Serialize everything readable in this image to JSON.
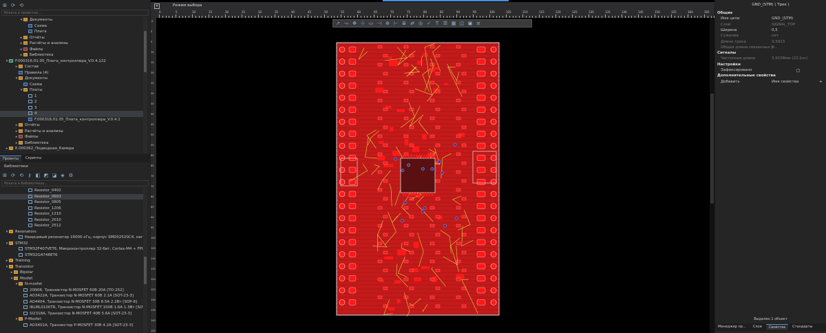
{
  "projects_panel": {
    "search_placeholder": "Искать в проектах...",
    "tree": [
      {
        "label": "Документы",
        "indent": 4,
        "icon": "folder",
        "arrow": "▾"
      },
      {
        "label": "Схема",
        "indent": 5,
        "icon": "doc",
        "arrow": ""
      },
      {
        "label": "Плата",
        "indent": 5,
        "icon": "doc",
        "arrow": ""
      },
      {
        "label": "Отчёты",
        "indent": 4,
        "icon": "folder",
        "arrow": "▸"
      },
      {
        "label": "Расчёты и анализы",
        "indent": 4,
        "icon": "folder",
        "arrow": "▸"
      },
      {
        "label": "Файлы",
        "indent": 4,
        "icon": "red",
        "arrow": "▸"
      },
      {
        "label": "Библиотека",
        "indent": 4,
        "icon": "folder",
        "arrow": "▸"
      },
      {
        "label": "F.000316.01.05_Плата_контроллера_V.0.4.122",
        "indent": 1,
        "icon": "cube",
        "arrow": "▾"
      },
      {
        "label": "Состав",
        "indent": 3,
        "icon": "folder",
        "arrow": "▸"
      },
      {
        "label": "Правила (4)",
        "indent": 3,
        "icon": "doc",
        "arrow": ""
      },
      {
        "label": "Документы",
        "indent": 3,
        "icon": "folder",
        "arrow": "▾"
      },
      {
        "label": "Схема",
        "indent": 4,
        "icon": "doc",
        "arrow": ""
      },
      {
        "label": "Платы",
        "indent": 4,
        "icon": "folder",
        "arrow": "▾"
      },
      {
        "label": "1",
        "indent": 5,
        "icon": "box",
        "arrow": ""
      },
      {
        "label": "2",
        "indent": 5,
        "icon": "box",
        "arrow": ""
      },
      {
        "label": "3",
        "indent": 5,
        "icon": "box",
        "arrow": ""
      },
      {
        "label": "4",
        "indent": 5,
        "icon": "box",
        "arrow": "",
        "sel": true
      },
      {
        "label": "F.000316.01.05_Плата_контроллера_V.0.4.1",
        "indent": 5,
        "icon": "doc",
        "arrow": ""
      },
      {
        "label": "Отчёты",
        "indent": 3,
        "icon": "folder",
        "arrow": "▸"
      },
      {
        "label": "Расчёты и анализы",
        "indent": 3,
        "icon": "folder",
        "arrow": "▸"
      },
      {
        "label": "Файлы",
        "indent": 3,
        "icon": "red",
        "arrow": "▸"
      },
      {
        "label": "Библиотека",
        "indent": 3,
        "icon": "folder",
        "arrow": "▸"
      },
      {
        "label": "E.000362_Подводная_Камера",
        "indent": 1,
        "icon": "folder",
        "arrow": "▸"
      }
    ],
    "tabs": [
      "Проекты",
      "Скрипты"
    ]
  },
  "libraries_panel": {
    "title": "Библиотеки",
    "search_placeholder": "Искать в библиотеках...",
    "tree": [
      {
        "label": "Resistor_0402",
        "indent": 5,
        "icon": "box",
        "arrow": ""
      },
      {
        "label": "Resistor_0603",
        "indent": 5,
        "icon": "box",
        "arrow": "",
        "sel": true
      },
      {
        "label": "Resistor_0805",
        "indent": 5,
        "icon": "box",
        "arrow": ""
      },
      {
        "label": "Resistor_1206",
        "indent": 5,
        "icon": "box",
        "arrow": ""
      },
      {
        "label": "Resistor_1210",
        "indent": 5,
        "icon": "box",
        "arrow": ""
      },
      {
        "label": "Resistor_2010",
        "indent": 5,
        "icon": "box",
        "arrow": ""
      },
      {
        "label": "Resistor_2512",
        "indent": 5,
        "icon": "box",
        "arrow": ""
      },
      {
        "label": "Resonators",
        "indent": 1,
        "icon": "folder",
        "arrow": "▾"
      },
      {
        "label": "Кварцевый резонатор 16000 кГц, корпус SMD02520C4, нагрузоч...",
        "indent": 3,
        "icon": "box",
        "arrow": ""
      },
      {
        "label": "STM32",
        "indent": 1,
        "icon": "folder",
        "arrow": "▾"
      },
      {
        "label": "STM32F407VET6, Микроконтроллер 32-бит, Cortex-M4 + FPU, 168...",
        "indent": 3,
        "icon": "box",
        "arrow": ""
      },
      {
        "label": "STM32G474RET6",
        "indent": 3,
        "icon": "box",
        "arrow": ""
      },
      {
        "label": "Training",
        "indent": 1,
        "icon": "folder",
        "arrow": "▸"
      },
      {
        "label": "Transistor",
        "indent": 1,
        "icon": "folder",
        "arrow": "▾"
      },
      {
        "label": "Bipolar",
        "indent": 2,
        "icon": "folder",
        "arrow": "▸"
      },
      {
        "label": "Mosfet",
        "indent": 2,
        "icon": "folder",
        "arrow": "▾"
      },
      {
        "label": "N-mosfet",
        "indent": 3,
        "icon": "folder",
        "arrow": "▾"
      },
      {
        "label": "20N06, Транзистор N-MOSFET 60В 20А [TO-252]",
        "indent": 4,
        "icon": "box",
        "arrow": ""
      },
      {
        "label": "AO3422A, Транзистор N-MOSFET 60В 2.1А [SOT-23-3]",
        "indent": 4,
        "icon": "box",
        "arrow": ""
      },
      {
        "label": "AO4404, Транзистор N-MOSFET 30В 8.5А 2.2Вт [SOP-8]",
        "indent": 4,
        "icon": "box",
        "arrow": ""
      },
      {
        "label": "IRLML0100TR, Транзистор N-MOSFET 100В 1.6А 1.3Вт [SOT...",
        "indent": 4,
        "icon": "box",
        "arrow": ""
      },
      {
        "label": "SI2318A, Транзистор N-MOSFET 40В 5.6А [SOT-23-3]",
        "indent": 4,
        "icon": "box",
        "arrow": ""
      },
      {
        "label": "P-Mosfet",
        "indent": 3,
        "icon": "folder",
        "arrow": "▾"
      },
      {
        "label": "AO3401A, Транзистор P-MOSFET 30В 4.2А [SOT-23-3]",
        "indent": 4,
        "icon": "box",
        "arrow": ""
      }
    ]
  },
  "editor": {
    "mode_label": "Режим выбора",
    "ruler_top": [
      "0",
      "5",
      "10",
      "15",
      "20",
      "25",
      "30",
      "35",
      "40",
      "45",
      "50",
      "55",
      "60",
      "65",
      "70",
      "75",
      "80",
      "85",
      "90",
      "95",
      "100",
      "105",
      "110",
      "115",
      "120",
      "125",
      "130",
      "135",
      "140",
      "145",
      "150",
      "155",
      "160",
      "165"
    ],
    "ruler_left": [
      "-5",
      "0",
      "5",
      "10",
      "15",
      "20",
      "25",
      "30",
      "35",
      "40",
      "45",
      "50",
      "55",
      "60",
      "65",
      "70",
      "75",
      "80",
      "85",
      "90",
      "95",
      "100",
      "105",
      "110",
      "115",
      "120",
      "125",
      "130",
      "135",
      "140",
      "145",
      "150"
    ]
  },
  "props_panel": {
    "title": "GND_(STM) ( Трек )",
    "sections": [
      {
        "name": "Общие",
        "rows": [
          {
            "k": "Имя цепи",
            "v": "GND_(STM)"
          },
          {
            "k": "Слой",
            "v": "SIGNAL_TOP",
            "dim": true
          },
          {
            "k": "Ширина",
            "v": "0,5"
          },
          {
            "k": "Сужение",
            "v": "нет",
            "dim": true
          },
          {
            "k": "Длина трека",
            "v": "3,5913",
            "dim": true
          },
          {
            "k": "Общая длина связанных у...",
            "v": "0",
            "dim": true
          }
        ]
      },
      {
        "name": "Сигналы",
        "rows": [
          {
            "k": "Частичная длина",
            "v": "3,9108мм (23,1nс)",
            "dim": true
          }
        ]
      },
      {
        "name": "Настройки",
        "rows": [
          {
            "k": "Зафиксировано",
            "v": ""
          }
        ]
      },
      {
        "name": "Дополнительные свойства",
        "rows": [
          {
            "k": "Добавить",
            "v": "Имя свойства"
          }
        ]
      }
    ],
    "status": "Выделен 1 объект",
    "bottom_tabs": [
      "Менеджер пр...",
      "Слои",
      "Свойства",
      "Стандарты"
    ]
  },
  "colors": {
    "board": "#c41a1a",
    "pad": "#ff1a1a",
    "copper_dark": "#8f1010",
    "track": "#dcdc40",
    "outline": "#e0e0e0",
    "accent": "#4a90d9"
  }
}
